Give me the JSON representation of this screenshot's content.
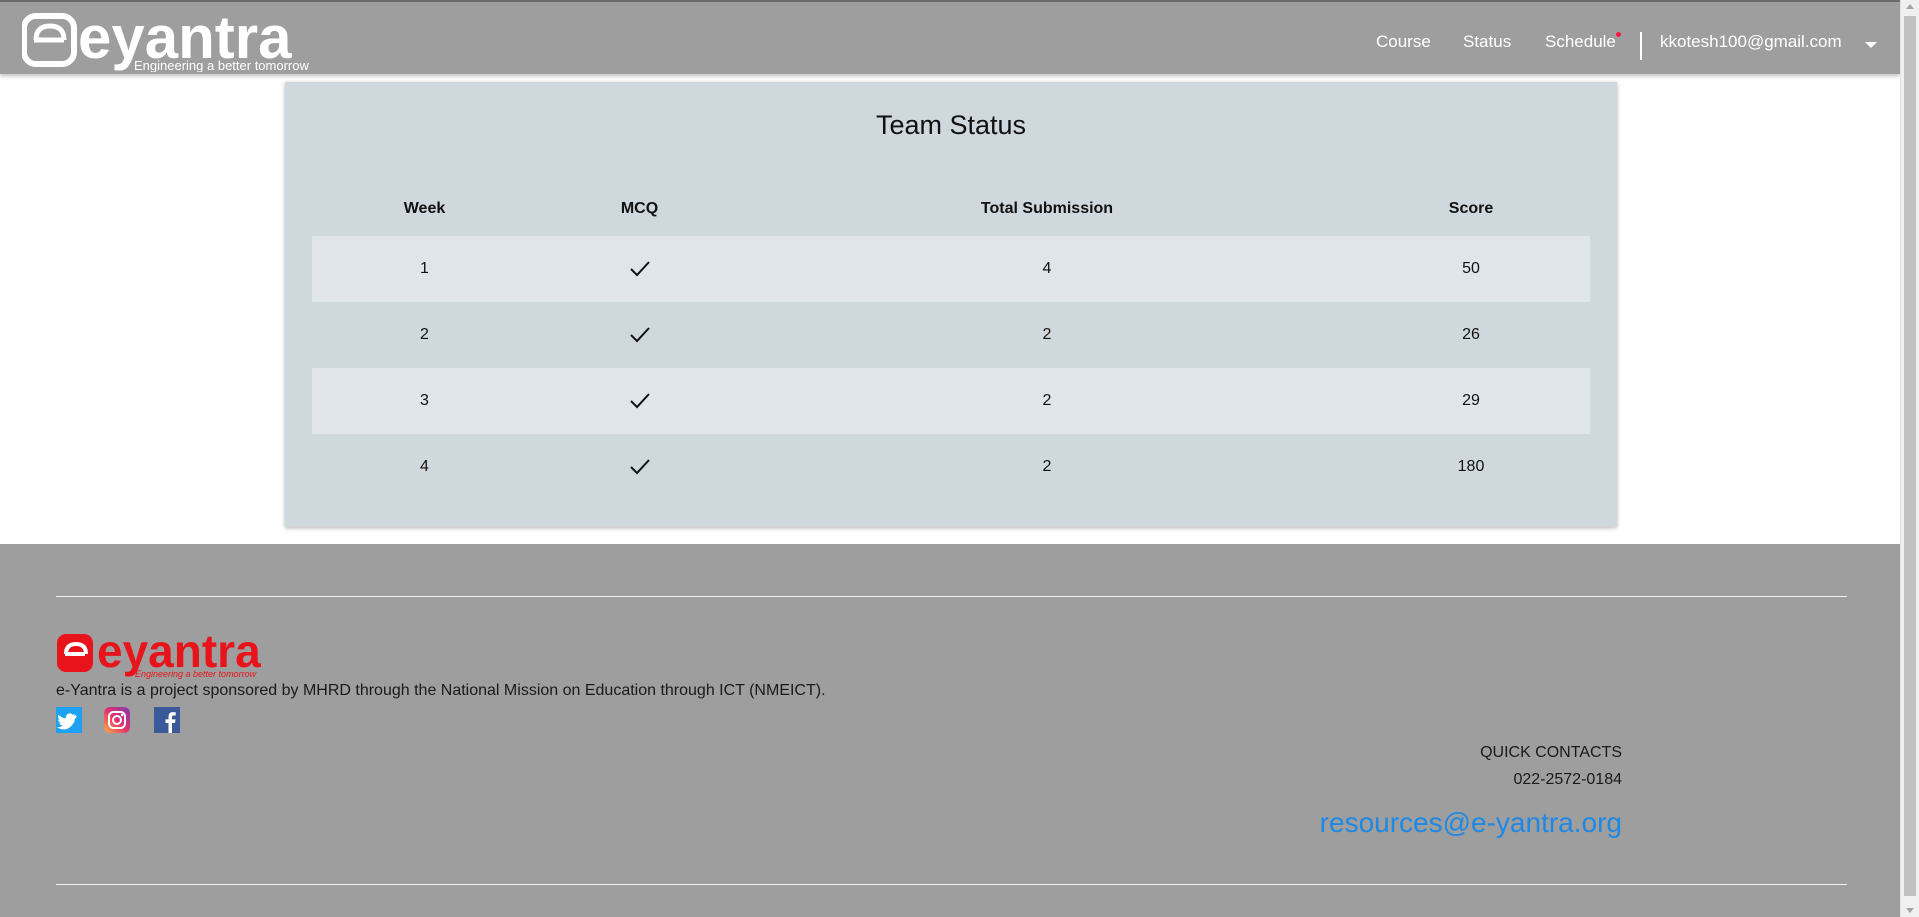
{
  "header": {
    "brand": {
      "name": "eyantra",
      "tagline": "Engineering a better tomorrow"
    },
    "nav": [
      {
        "label": "Course"
      },
      {
        "label": "Status"
      },
      {
        "label": "Schedule"
      }
    ],
    "user_email": "kkotesh100@gmail.com"
  },
  "main": {
    "title": "Team Status",
    "table": {
      "columns": [
        "Week",
        "MCQ",
        "Total Submission",
        "Score"
      ],
      "rows": [
        {
          "week": "1",
          "mcq_icon": "check-icon",
          "total_submission": "4",
          "score": "50"
        },
        {
          "week": "2",
          "mcq_icon": "check-icon",
          "total_submission": "2",
          "score": "26"
        },
        {
          "week": "3",
          "mcq_icon": "check-icon",
          "total_submission": "2",
          "score": "29"
        },
        {
          "week": "4",
          "mcq_icon": "check-icon",
          "total_submission": "2",
          "score": "180"
        }
      ]
    }
  },
  "footer": {
    "brand": {
      "name": "eyantra",
      "tagline": "Engineering a better tomorrow"
    },
    "sponsor_text": "e-Yantra is a project sponsored by MHRD through the National Mission on Education through ICT (NMEICT).",
    "social_icons": [
      "twitter-icon",
      "instagram-icon",
      "facebook-icon"
    ],
    "quick_contacts_label": "QUICK CONTACTS",
    "phone": "022-2572-0184",
    "email": "resources@e-yantra.org"
  },
  "colors": {
    "header_bg": "#9e9e9e",
    "card_bg": "#cfd8dc",
    "row_alt_bg": "#dfe5e8",
    "footer_bg": "#9e9e9e",
    "brand_red": "#e8141b",
    "link_blue": "#1e88e5",
    "notification_dot": "#ff1744"
  }
}
